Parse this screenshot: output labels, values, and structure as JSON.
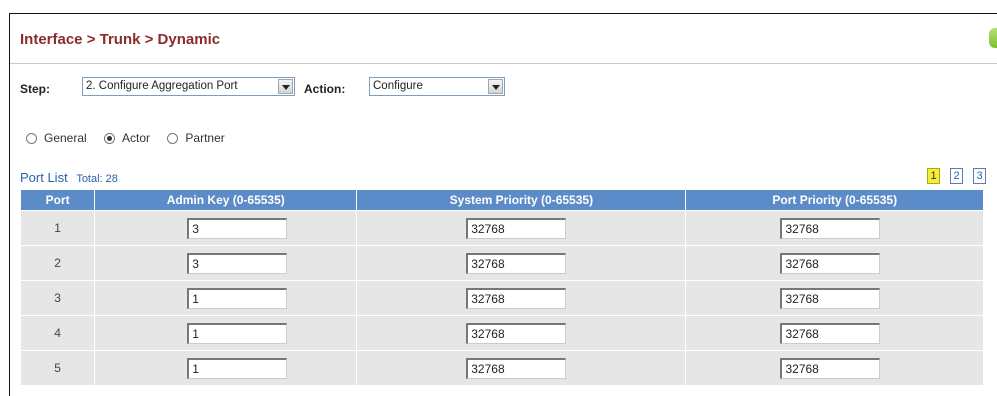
{
  "header": {
    "breadcrumb": "Interface > Trunk > Dynamic"
  },
  "step_bar": {
    "step_label": "Step:",
    "step_value": "2. Configure Aggregation Port",
    "action_label": "Action:",
    "action_value": "Configure"
  },
  "radios": [
    {
      "label": "General",
      "checked": false
    },
    {
      "label": "Actor",
      "checked": true
    },
    {
      "label": "Partner",
      "checked": false
    }
  ],
  "port_list": {
    "title": "Port List",
    "total": "Total: 28",
    "pages": [
      "1",
      "2",
      "3"
    ],
    "active_page": "1"
  },
  "table": {
    "headers": [
      "Port",
      "Admin Key (0-65535)",
      "System Priority (0-65535)",
      "Port Priority (0-65535)"
    ],
    "rows": [
      {
        "port": "1",
        "admin_key": "3",
        "system_priority": "32768",
        "port_priority": "32768"
      },
      {
        "port": "2",
        "admin_key": "3",
        "system_priority": "32768",
        "port_priority": "32768"
      },
      {
        "port": "3",
        "admin_key": "1",
        "system_priority": "32768",
        "port_priority": "32768"
      },
      {
        "port": "4",
        "admin_key": "1",
        "system_priority": "32768",
        "port_priority": "32768"
      },
      {
        "port": "5",
        "admin_key": "1",
        "system_priority": "32768",
        "port_priority": "32768"
      }
    ]
  },
  "colors": {
    "title": "#8b2b2b",
    "table_header_bg": "#5b8cc9",
    "row_bg": "#e6e6e6",
    "link": "#2b5fa8",
    "active_page_bg": "#f2ee3a"
  }
}
